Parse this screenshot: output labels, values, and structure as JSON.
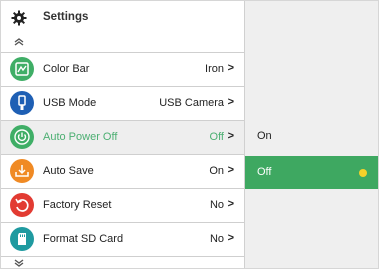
{
  "header": {
    "title": "Settings",
    "icon": "gear-icon"
  },
  "menu": [
    {
      "label": "Color Bar",
      "value": "Iron",
      "icon": "palette-icon",
      "color": "#3fae66"
    },
    {
      "label": "USB Mode",
      "value": "USB Camera",
      "icon": "usb-icon",
      "color": "#1e5fb4"
    },
    {
      "label": "Auto Power Off",
      "value": "Off",
      "icon": "power-icon",
      "color": "#3fae66",
      "selected": true
    },
    {
      "label": "Auto Save",
      "value": "On",
      "icon": "save-download-icon",
      "color": "#f08a24"
    },
    {
      "label": "Factory Reset",
      "value": "No",
      "icon": "reset-icon",
      "color": "#e23b32"
    },
    {
      "label": "Format SD Card",
      "value": "No",
      "icon": "sd-card-icon",
      "color": "#1f9aa0"
    }
  ],
  "chevron": ">",
  "submenu": {
    "options": [
      {
        "label": "On",
        "active": false
      },
      {
        "label": "Off",
        "active": true
      }
    ]
  },
  "colors": {
    "accent": "#3ea861",
    "selected_text": "#4caf72",
    "indicator": "#f5d12a"
  }
}
